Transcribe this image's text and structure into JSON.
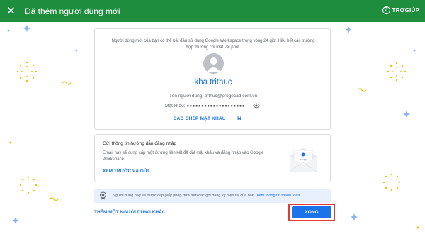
{
  "header": {
    "title": "Đã thêm người dùng mới",
    "close_icon": "close-icon",
    "help_label": "TRỢGIÚP",
    "help_icon": "help-circle-icon",
    "bg_color": "#1e8e3e"
  },
  "user_card": {
    "info_text": "Người dùng mới của bạn có thể bắt đầu sử dụng Google Workspace trong vòng 24 giờ. Hầu hết các trường hợp thường chỉ mất vài phút.",
    "avatar_icon": "person-avatar-icon",
    "display_name": "kha trithuc",
    "username_label": "Tên người dùng:",
    "username_value": "trithuc@progecad.com.vn",
    "password_label": "Mật khẩu:",
    "password_mask": "●●●●●●●●●●●●●●●●●●●●",
    "eye_icon": "visibility-icon",
    "copy_password_label": "SAO CHÉP MẬT KHẨU",
    "print_label": "IN"
  },
  "instructions_card": {
    "title": "Gửi thông tin hướng dẫn đăng nhập",
    "description": "Email này sẽ cung cấp một đường liên kết để đặt mật khẩu và đăng nhập vào Google Workspace",
    "preview_send_label": "XEM TRƯỚC VÀ GỬI",
    "illustration": "envelope-illustration"
  },
  "notice": {
    "icon": "license-badge-icon",
    "text": "Người dùng này sẽ được cấp giấy phép dựa trên các gói đăng ký hiện tại của bạn.",
    "link_label": "Xem thông tin thanh toán"
  },
  "footer": {
    "add_another_label": "THÊM MỘT NGƯỜI DÙNG KHÁC",
    "done_label": "XONG",
    "done_color": "#1a73e8",
    "highlight_color": "#e53935"
  }
}
